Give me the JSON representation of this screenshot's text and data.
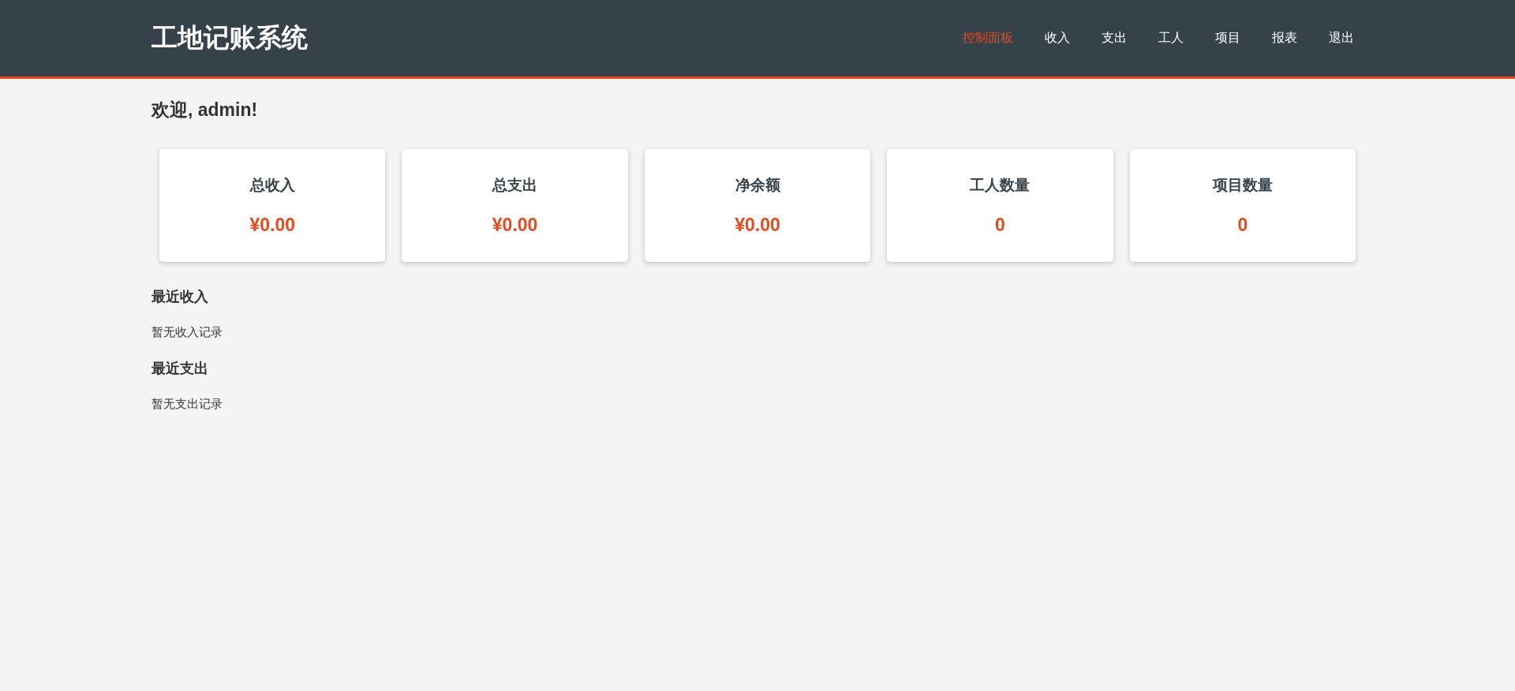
{
  "header": {
    "title": "工地记账系统",
    "nav": [
      {
        "label": "控制面板",
        "selected": true
      },
      {
        "label": "收入",
        "selected": false
      },
      {
        "label": "支出",
        "selected": false
      },
      {
        "label": "工人",
        "selected": false
      },
      {
        "label": "项目",
        "selected": false
      },
      {
        "label": "报表",
        "selected": false
      },
      {
        "label": "退出",
        "selected": false
      }
    ]
  },
  "welcome": "欢迎, admin!",
  "stats": [
    {
      "label": "总收入",
      "value": "¥0.00"
    },
    {
      "label": "总支出",
      "value": "¥0.00"
    },
    {
      "label": "净余额",
      "value": "¥0.00"
    },
    {
      "label": "工人数量",
      "value": "0"
    },
    {
      "label": "项目数量",
      "value": "0"
    }
  ],
  "sections": [
    {
      "heading": "最近收入",
      "empty_text": "暂无收入记录"
    },
    {
      "heading": "最近支出",
      "empty_text": "暂无支出记录"
    }
  ]
}
